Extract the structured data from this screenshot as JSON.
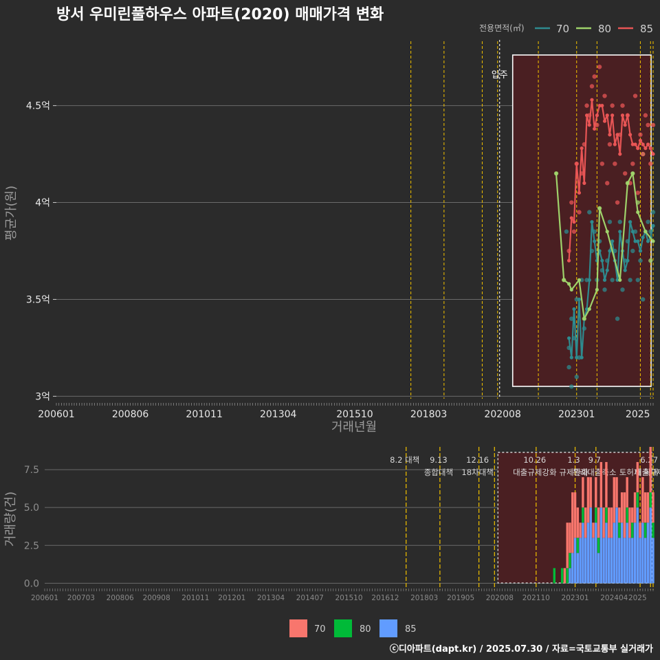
{
  "title": "방서 우미린풀하우스 아파트(2020) 매매가격 변화",
  "footer": "ⓒ디아파트(dapt.kr) / 2025.07.30 / 자료=국토교통부 실거래가",
  "move_in_label": "입주",
  "colors": {
    "s70": "#2e8b8f",
    "s80": "#9fd36b",
    "s85": "#e85555",
    "bar70": "#f8766d",
    "bar80": "#00ba38",
    "bar85": "#619cff",
    "policy": "#e6b800",
    "grid": "#6b6b6b",
    "bg": "#2b2b2b",
    "shade": "#4a1f22"
  },
  "chart_data": [
    {
      "type": "line",
      "title": "방서 우미린풀하우스 아파트(2020) 매매가격 변화",
      "xlabel": "거래년월",
      "ylabel": "평균가(원)",
      "x_ticks": [
        "200601",
        "200806",
        "201011",
        "201304",
        "201510",
        "201803",
        "202008",
        "202301",
        "2025"
      ],
      "y_ticks": [
        "3억",
        "3.5억",
        "4억",
        "4.5억"
      ],
      "ylim": [
        2.98,
        4.85
      ],
      "legend_title": "전용면적(㎡)",
      "legend_position": "top-right",
      "series": [
        {
          "name": "70",
          "x": [
            "2022-10",
            "2022-11",
            "2022-12",
            "2023-01",
            "2023-02",
            "2023-03",
            "2023-04",
            "2023-05",
            "2023-06",
            "2023-07",
            "2023-08",
            "2023-09",
            "2023-10",
            "2023-11",
            "2023-12",
            "2024-01",
            "2024-02",
            "2024-03",
            "2024-04",
            "2024-05",
            "2024-06",
            "2024-07",
            "2024-08",
            "2024-09",
            "2024-10",
            "2024-11",
            "2024-12",
            "2025-01",
            "2025-02",
            "2025-03",
            "2025-04",
            "2025-05",
            "2025-06",
            "2025-07"
          ],
          "values": [
            3.3,
            3.2,
            3.45,
            3.2,
            3.5,
            3.2,
            3.4,
            3.45,
            3.6,
            3.9,
            3.8,
            3.7,
            3.75,
            3.7,
            3.6,
            3.65,
            3.75,
            3.8,
            3.7,
            3.6,
            3.85,
            3.75,
            3.65,
            3.7,
            3.9,
            3.85,
            3.8,
            3.8,
            3.75,
            3.82,
            3.85,
            3.8,
            3.82,
            3.88
          ]
        },
        {
          "name": "80",
          "x": [
            "2022-05",
            "2022-08",
            "2022-10",
            "2022-11",
            "2023-02",
            "2023-04",
            "2023-06",
            "2023-09",
            "2023-10",
            "2024-01",
            "2024-06",
            "2024-09",
            "2024-11",
            "2025-01",
            "2025-04",
            "2025-07"
          ],
          "values": [
            4.15,
            3.6,
            3.58,
            3.55,
            3.6,
            3.4,
            3.45,
            3.55,
            3.97,
            3.85,
            3.6,
            4.1,
            4.15,
            3.95,
            3.85,
            3.8
          ]
        },
        {
          "name": "85",
          "x": [
            "2022-10",
            "2022-11",
            "2022-12",
            "2023-01",
            "2023-02",
            "2023-03",
            "2023-04",
            "2023-05",
            "2023-06",
            "2023-07",
            "2023-08",
            "2023-09",
            "2023-10",
            "2023-11",
            "2023-12",
            "2024-01",
            "2024-02",
            "2024-03",
            "2024-04",
            "2024-05",
            "2024-06",
            "2024-07",
            "2024-08",
            "2024-09",
            "2024-10",
            "2024-11",
            "2024-12",
            "2025-01",
            "2025-02",
            "2025-03",
            "2025-04",
            "2025-05",
            "2025-06",
            "2025-07"
          ],
          "values": [
            3.7,
            3.92,
            3.9,
            4.2,
            4.05,
            4.28,
            4.1,
            4.45,
            4.4,
            4.53,
            4.38,
            4.45,
            4.5,
            4.5,
            4.42,
            4.45,
            4.35,
            4.45,
            4.3,
            4.35,
            4.25,
            4.45,
            4.4,
            4.45,
            4.35,
            4.3,
            4.3,
            4.28,
            4.32,
            4.3,
            4.28,
            4.3,
            4.28,
            4.25
          ]
        }
      ],
      "scatter": {
        "70": [
          [
            "2022-09",
            3.85
          ],
          [
            "2022-10",
            3.25
          ],
          [
            "2022-10",
            3.15
          ],
          [
            "2022-11",
            3.05
          ],
          [
            "2022-11",
            3.4
          ],
          [
            "2022-12",
            3.3
          ],
          [
            "2023-01",
            3.5
          ],
          [
            "2023-01",
            3.1
          ],
          [
            "2023-02",
            3.2
          ],
          [
            "2023-03",
            3.6
          ],
          [
            "2023-04",
            3.35
          ],
          [
            "2023-05",
            3.6
          ],
          [
            "2023-06",
            3.95
          ],
          [
            "2023-07",
            3.75
          ],
          [
            "2023-08",
            3.85
          ],
          [
            "2023-09",
            3.6
          ],
          [
            "2023-10",
            3.8
          ],
          [
            "2023-11",
            3.65
          ],
          [
            "2023-12",
            3.55
          ],
          [
            "2024-01",
            3.7
          ],
          [
            "2024-02",
            3.9
          ],
          [
            "2024-03",
            3.6
          ],
          [
            "2024-04",
            3.75
          ],
          [
            "2024-05",
            3.4
          ],
          [
            "2024-06",
            3.9
          ],
          [
            "2024-07",
            3.55
          ],
          [
            "2024-08",
            3.7
          ],
          [
            "2024-09",
            3.8
          ],
          [
            "2024-10",
            3.6
          ],
          [
            "2024-11",
            3.75
          ],
          [
            "2024-12",
            3.85
          ],
          [
            "2025-01",
            3.6
          ],
          [
            "2025-02",
            3.7
          ],
          [
            "2025-03",
            3.5
          ],
          [
            "2025-04",
            3.85
          ],
          [
            "2025-05",
            3.9
          ],
          [
            "2025-06",
            3.85
          ],
          [
            "2025-07",
            3.95
          ]
        ],
        "80": [
          [
            "2022-05",
            4.15
          ],
          [
            "2022-08",
            3.6
          ],
          [
            "2023-04",
            3.4
          ],
          [
            "2023-10",
            3.97
          ],
          [
            "2024-09",
            4.1
          ],
          [
            "2024-11",
            4.15
          ],
          [
            "2025-01",
            4.0
          ],
          [
            "2025-03",
            4.25
          ],
          [
            "2025-06",
            3.7
          ]
        ],
        "85": [
          [
            "2022-10",
            3.75
          ],
          [
            "2022-11",
            4.0
          ],
          [
            "2022-12",
            3.85
          ],
          [
            "2023-01",
            4.2
          ],
          [
            "2023-02",
            3.95
          ],
          [
            "2023-03",
            4.15
          ],
          [
            "2023-04",
            4.3
          ],
          [
            "2023-05",
            4.5
          ],
          [
            "2023-06",
            4.45
          ],
          [
            "2023-07",
            4.6
          ],
          [
            "2023-08",
            4.65
          ],
          [
            "2023-09",
            4.4
          ],
          [
            "2023-10",
            4.7
          ],
          [
            "2023-11",
            4.2
          ],
          [
            "2023-12",
            4.55
          ],
          [
            "2024-01",
            4.1
          ],
          [
            "2024-02",
            4.3
          ],
          [
            "2024-03",
            4.5
          ],
          [
            "2024-04",
            4.2
          ],
          [
            "2024-05",
            4.0
          ],
          [
            "2024-06",
            4.35
          ],
          [
            "2024-07",
            4.5
          ],
          [
            "2024-08",
            4.15
          ],
          [
            "2024-09",
            4.45
          ],
          [
            "2024-10",
            4.1
          ],
          [
            "2024-11",
            4.2
          ],
          [
            "2024-12",
            4.55
          ],
          [
            "2025-01",
            4.05
          ],
          [
            "2025-02",
            4.35
          ],
          [
            "2025-03",
            4.25
          ],
          [
            "2025-04",
            4.45
          ],
          [
            "2025-05",
            4.4
          ],
          [
            "2025-06",
            4.2
          ],
          [
            "2025-07",
            4.4
          ]
        ]
      }
    },
    {
      "type": "bar",
      "ylabel": "거래량(건)",
      "x_ticks": [
        "200601",
        "200703",
        "200806",
        "200908",
        "201011",
        "201201",
        "201304",
        "201407",
        "201510",
        "201612",
        "201803",
        "201905",
        "202008",
        "202110",
        "202301",
        "202404",
        "2025"
      ],
      "y_ticks": [
        "0.0",
        "2.5",
        "5.0",
        "7.5"
      ],
      "ylim": [
        -0.3,
        9.0
      ],
      "legend_position": "bottom",
      "legend": [
        "70",
        "80",
        "85"
      ],
      "series": [
        {
          "name": "70",
          "x": [
            "2022-05",
            "2022-08",
            "2022-09",
            "2022-10",
            "2022-11",
            "2022-12",
            "2023-01",
            "2023-02",
            "2023-03",
            "2023-04",
            "2023-05",
            "2023-06",
            "2023-07",
            "2023-08",
            "2023-09",
            "2023-10",
            "2023-11",
            "2023-12",
            "2024-01",
            "2024-02",
            "2024-03",
            "2024-04",
            "2024-05",
            "2024-06",
            "2024-07",
            "2024-08",
            "2024-09",
            "2024-10",
            "2024-11",
            "2024-12",
            "2025-01",
            "2025-02",
            "2025-03",
            "2025-04",
            "2025-05",
            "2025-06",
            "2025-07"
          ],
          "values": [
            0,
            0,
            1,
            3,
            2,
            4,
            3,
            2,
            1,
            2,
            2,
            3,
            2,
            1,
            2,
            2,
            3,
            2,
            3,
            2,
            2,
            3,
            2,
            1,
            2,
            3,
            2,
            2,
            1,
            2,
            2,
            1,
            3,
            2,
            2,
            3,
            2
          ]
        },
        {
          "name": "80",
          "x": [
            "2022-05",
            "2022-08",
            "2022-09",
            "2022-10",
            "2022-11",
            "2022-12",
            "2023-01",
            "2023-02",
            "2023-03",
            "2023-04",
            "2023-05",
            "2023-06",
            "2023-07",
            "2023-08",
            "2023-09",
            "2023-10",
            "2023-11",
            "2023-12",
            "2024-01",
            "2024-02",
            "2024-03",
            "2024-04",
            "2024-05",
            "2024-06",
            "2024-07",
            "2024-08",
            "2024-09",
            "2024-10",
            "2024-11",
            "2024-12",
            "2025-01",
            "2025-02",
            "2025-03",
            "2025-04",
            "2025-05",
            "2025-06",
            "2025-07"
          ],
          "values": [
            1,
            1,
            0,
            1,
            1,
            0,
            0,
            1,
            0,
            1,
            0,
            0,
            0,
            0,
            1,
            1,
            0,
            0,
            1,
            0,
            0,
            0,
            0,
            1,
            0,
            0,
            1,
            0,
            1,
            0,
            1,
            0,
            0,
            1,
            0,
            1,
            1
          ]
        },
        {
          "name": "85",
          "x": [
            "2022-05",
            "2022-08",
            "2022-09",
            "2022-10",
            "2022-11",
            "2022-12",
            "2023-01",
            "2023-02",
            "2023-03",
            "2023-04",
            "2023-05",
            "2023-06",
            "2023-07",
            "2023-08",
            "2023-09",
            "2023-10",
            "2023-11",
            "2023-12",
            "2024-01",
            "2024-02",
            "2024-03",
            "2024-04",
            "2024-05",
            "2024-06",
            "2024-07",
            "2024-08",
            "2024-09",
            "2024-10",
            "2024-11",
            "2024-12",
            "2025-01",
            "2025-02",
            "2025-03",
            "2025-04",
            "2025-05",
            "2025-06",
            "2025-07"
          ],
          "values": [
            0,
            0,
            0,
            0,
            1,
            2,
            3,
            2,
            3,
            4,
            3,
            4,
            5,
            3,
            4,
            2,
            5,
            3,
            4,
            3,
            3,
            4,
            5,
            3,
            4,
            3,
            4,
            3,
            3,
            4,
            5,
            3,
            4,
            3,
            4,
            5,
            3
          ]
        }
      ]
    }
  ],
  "policy_events": [
    {
      "date": "2017-08",
      "label": "8.2 대책",
      "label2": ""
    },
    {
      "date": "2018-09",
      "label": "9.13",
      "label2": "종합대책"
    },
    {
      "date": "2019-12",
      "label": "12.16",
      "label2": "18차대책"
    },
    {
      "date": "2020-06",
      "label": "",
      "label2": ""
    },
    {
      "date": "2021-10",
      "label": "10.26",
      "label2": "대출규제강화"
    },
    {
      "date": "2023-01",
      "label": "1.3",
      "label2": "규제완화"
    },
    {
      "date": "2023-09",
      "label": "9.7",
      "label2": "특례대출축소"
    },
    {
      "date": "2025-02",
      "label": "",
      "label2": "토허제 확대"
    },
    {
      "date": "2025-06",
      "label": "6.27",
      "label2": "대출규제"
    },
    {
      "date": "2025-07",
      "label": "",
      "label2": ""
    }
  ]
}
